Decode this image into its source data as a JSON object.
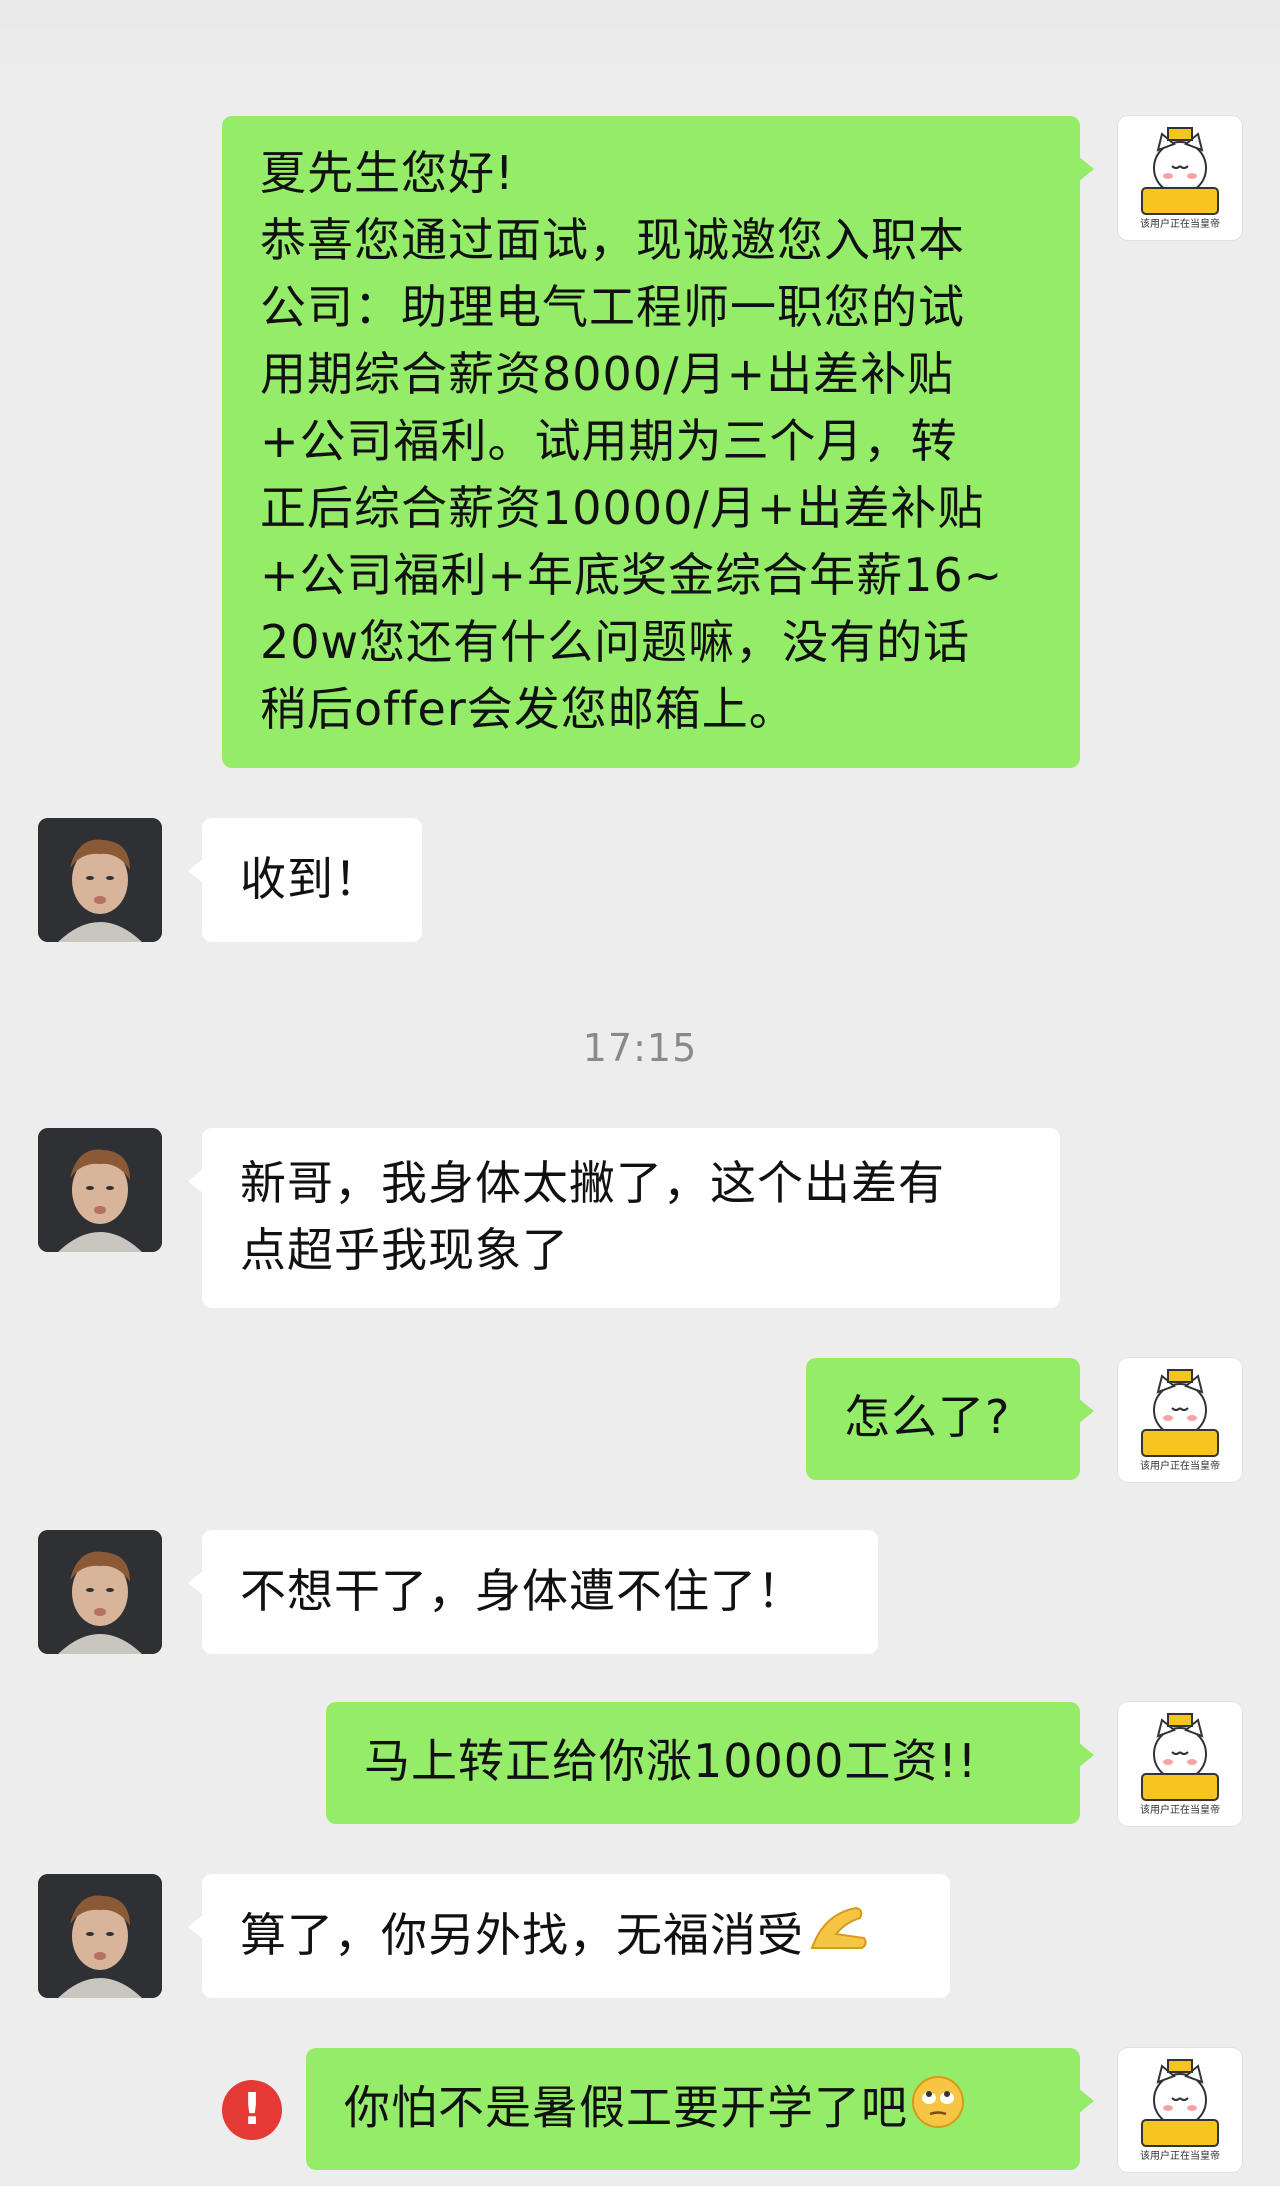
{
  "messages": [
    {
      "side": "right",
      "text_lines": [
        "夏先生您好!",
        "恭喜您通过面试，现诚邀您入职本",
        "公司：助理电气工程师一职您的试",
        "用期综合薪资8000/月+出差补贴",
        "+公司福利。试用期为三个月，转",
        "正后综合薪资10000/月+出差补贴",
        "+公司福利+年底奖金综合年薪16~",
        "20w您还有什么问题嘛，没有的话",
        "稍后offer会发您邮箱上。"
      ]
    },
    {
      "side": "left",
      "text": "收到！"
    },
    {
      "side": "left",
      "text_lines": [
        "新哥，我身体太撇了，这个出差有",
        "点超乎我现象了"
      ]
    },
    {
      "side": "right",
      "text": "怎么了?"
    },
    {
      "side": "left",
      "text": "不想干了，身体遭不住了！"
    },
    {
      "side": "right",
      "text": "马上转正给你涨10000工资!!"
    },
    {
      "side": "left",
      "text": "算了，你另外找，无福消受",
      "emoji": "ok-hand"
    },
    {
      "side": "right",
      "text": "你怕不是暑假工要开学了吧",
      "emoji": "rolling-eyes",
      "status": "failed"
    }
  ],
  "timestamp": "17:15",
  "avatar_caption": "该用户正在当皇帝",
  "alert_glyph": "!",
  "colors": {
    "background": "#ededed",
    "sent_bubble": "#95ec69",
    "received_bubble": "#ffffff",
    "alert": "#e53935",
    "timestamp": "#8a8a8a"
  }
}
